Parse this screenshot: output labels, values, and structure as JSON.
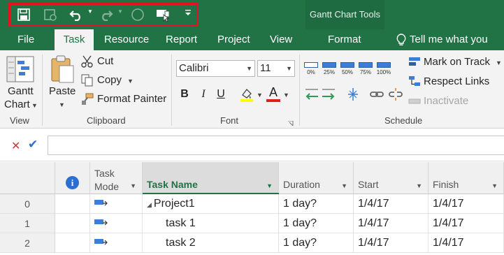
{
  "title_bar": {
    "context_group": "Gantt Chart Tools",
    "qat_icons": [
      "save-icon",
      "save-baseline-icon",
      "undo-icon",
      "redo-icon",
      "circle-icon",
      "touch-mode-icon",
      "customize-qat-icon"
    ]
  },
  "tabs": [
    {
      "label": "File",
      "active": false
    },
    {
      "label": "Task",
      "active": true
    },
    {
      "label": "Resource",
      "active": false
    },
    {
      "label": "Report",
      "active": false
    },
    {
      "label": "Project",
      "active": false
    },
    {
      "label": "View",
      "active": false
    },
    {
      "label": "Format",
      "active": false
    }
  ],
  "tell_me": "Tell me what you wa",
  "ribbon": {
    "view": {
      "gantt_line1": "Gantt",
      "gantt_line2": "Chart",
      "group_label": "View"
    },
    "clipboard": {
      "paste": "Paste",
      "cut": "Cut",
      "copy": "Copy",
      "format_painter": "Format Painter",
      "group_label": "Clipboard"
    },
    "font": {
      "font_name": "Calibri",
      "font_size": "11",
      "bold": "B",
      "italic": "I",
      "underline": "U",
      "font_color": "A",
      "group_label": "Font"
    },
    "schedule": {
      "percent_labels": [
        "0%",
        "25%",
        "50%",
        "75%",
        "100%"
      ],
      "mark_on_track": "Mark on Track",
      "respect_links": "Respect Links",
      "inactivate": "Inactivate",
      "group_label": "Schedule"
    }
  },
  "entry_bar": {
    "value": ""
  },
  "grid": {
    "columns": {
      "info": "i",
      "mode_line1": "Task",
      "mode_line2": "Mode",
      "name": "Task Name",
      "duration": "Duration",
      "start": "Start",
      "finish": "Finish"
    },
    "rows": [
      {
        "id": "0",
        "name": "Project1",
        "duration": "1 day?",
        "start": "1/4/17",
        "finish": "1/4/17",
        "summary": true
      },
      {
        "id": "1",
        "name": "task 1",
        "duration": "1 day?",
        "start": "1/4/17",
        "finish": "1/4/17",
        "summary": false
      },
      {
        "id": "2",
        "name": "task 2",
        "duration": "1 day?",
        "start": "1/4/17",
        "finish": "1/4/17",
        "summary": false
      }
    ]
  },
  "colors": {
    "brand_green": "#217346",
    "highlight_red": "#e81123",
    "accent_blue": "#3b7dd8"
  }
}
